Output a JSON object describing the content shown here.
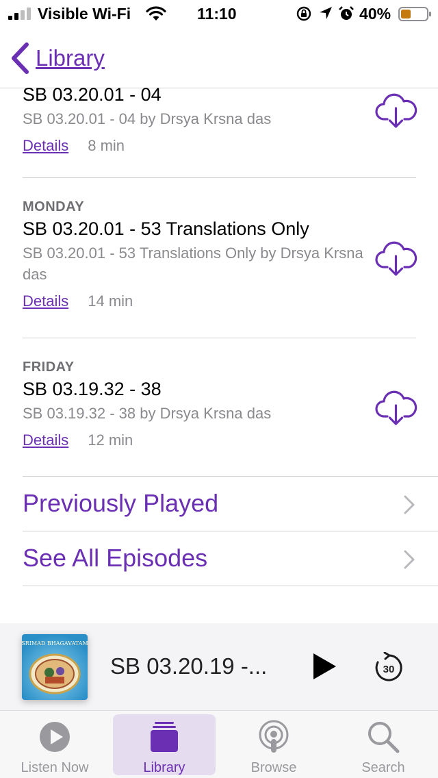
{
  "status_bar": {
    "carrier": "Visible Wi-Fi",
    "time": "11:10",
    "battery_percent": "40%",
    "battery_level": 0.4,
    "battery_color": "#c47a0f"
  },
  "nav": {
    "back_label": "Library",
    "accent_color": "#6b2fb3"
  },
  "episodes": [
    {
      "day": "",
      "title": "SB 03.20.01 - 04",
      "description": "SB 03.20.01 - 04 by Drsya Krsna das",
      "details_label": "Details",
      "duration": "8 min",
      "icon": "cloud-download-icon"
    },
    {
      "day": "MONDAY",
      "title": "SB 03.20.01 - 53 Translations Only",
      "description": "SB 03.20.01 - 53 Translations Only by Drsya Krsna das",
      "details_label": "Details",
      "duration": "14 min",
      "icon": "cloud-download-icon"
    },
    {
      "day": "FRIDAY",
      "title": "SB 03.19.32 - 38",
      "description": "SB 03.19.32 - 38 by Drsya Krsna das",
      "details_label": "Details",
      "duration": "12 min",
      "icon": "cloud-download-icon"
    }
  ],
  "rows": [
    {
      "label": "Previously Played",
      "icon": "chevron-right-icon"
    },
    {
      "label": "See All Episodes",
      "icon": "chevron-right-icon"
    }
  ],
  "now_playing": {
    "title": "SB 03.20.19 -...",
    "artwork_text": "SRIMAD BHAGAVATAM",
    "skip_label": "30"
  },
  "tabs": [
    {
      "label": "Listen Now",
      "icon": "play-circle-icon",
      "active": false
    },
    {
      "label": "Library",
      "icon": "library-stack-icon",
      "active": true
    },
    {
      "label": "Browse",
      "icon": "podcast-icon",
      "active": false
    },
    {
      "label": "Search",
      "icon": "search-icon",
      "active": false
    }
  ]
}
